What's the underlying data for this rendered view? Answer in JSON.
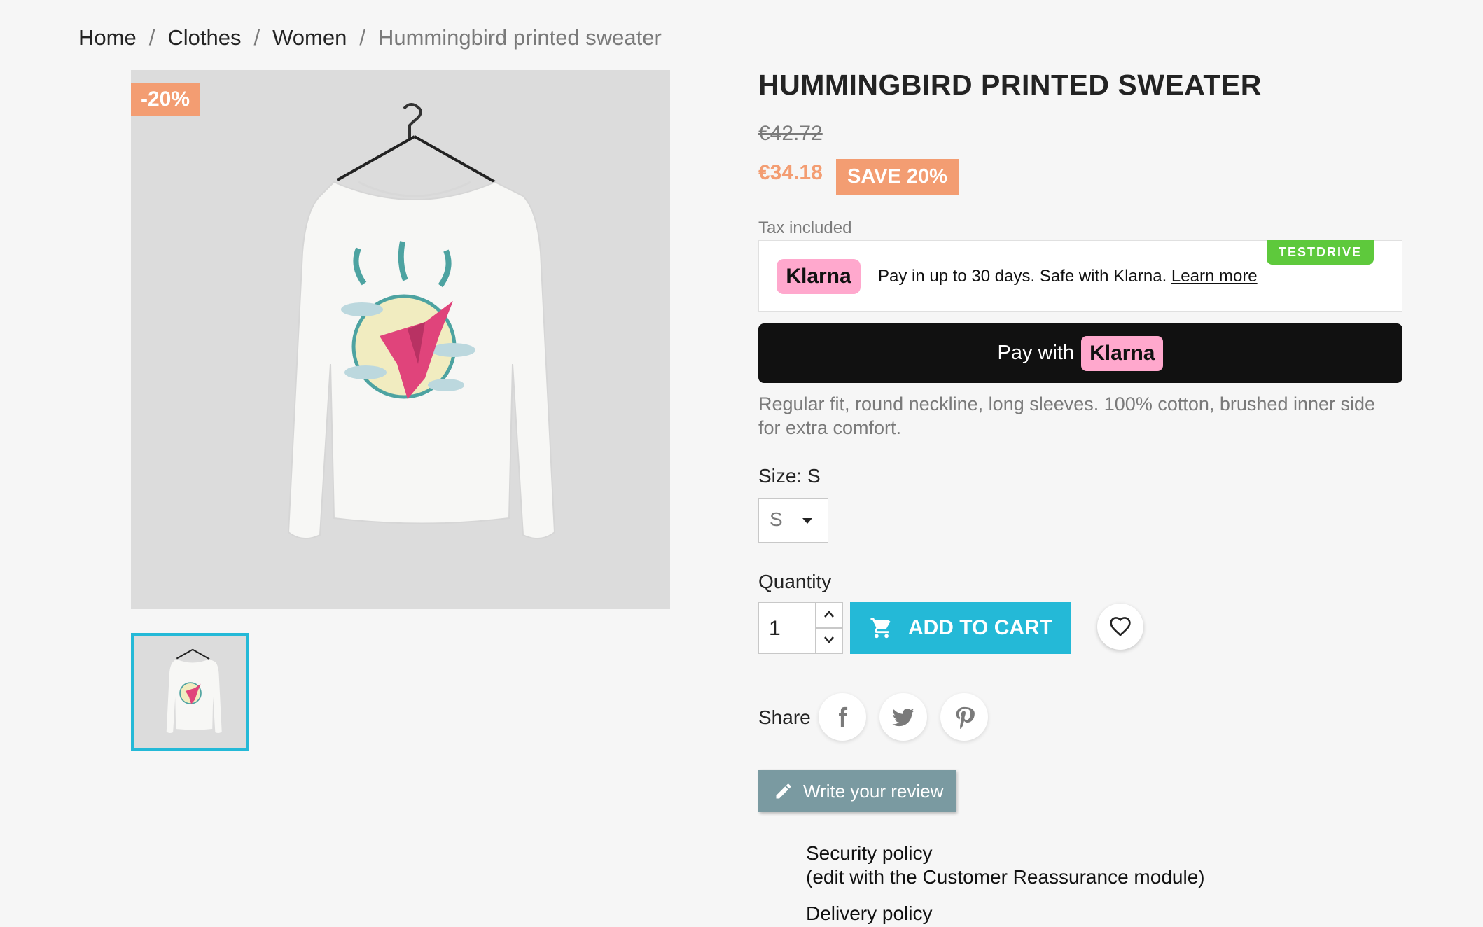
{
  "breadcrumb": {
    "items": [
      "Home",
      "Clothes",
      "Women"
    ],
    "current": "Hummingbird printed sweater",
    "separator": "/"
  },
  "product": {
    "title": "HUMMINGBIRD PRINTED SWEATER",
    "discount_flag": "-20%",
    "old_price": "€42.72",
    "price": "€34.18",
    "save_badge": "SAVE 20%",
    "tax_note": "Tax included",
    "description": "Regular fit, round neckline, long sleeves. 100% cotton, brushed inner side for extra comfort."
  },
  "klarna": {
    "testdrive": "TESTDRIVE",
    "logo": "Klarna",
    "message": "Pay in up to 30 days. Safe with Klarna.",
    "learn_more": "Learn more",
    "pay_button_prefix": "Pay with",
    "pay_button_logo": "Klarna"
  },
  "size": {
    "label": "Size: S",
    "selected": "S"
  },
  "quantity": {
    "label": "Quantity",
    "value": "1"
  },
  "actions": {
    "add_to_cart": "ADD TO CART",
    "share_label": "Share",
    "write_review": "Write your review"
  },
  "reassurance": {
    "security_title": "Security policy",
    "security_sub": "(edit with the Customer Reassurance module)",
    "delivery_title": "Delivery policy"
  },
  "colors": {
    "accent": "#24b9d7",
    "discount": "#f39d72",
    "klarna_pink": "#ffa8cd",
    "testdrive_green": "#5ec93c"
  },
  "icons": [
    "cart-icon",
    "heart-icon",
    "facebook-icon",
    "twitter-icon",
    "pinterest-icon",
    "pencil-icon",
    "chevron-up-icon",
    "chevron-down-icon",
    "caret-down-icon"
  ]
}
